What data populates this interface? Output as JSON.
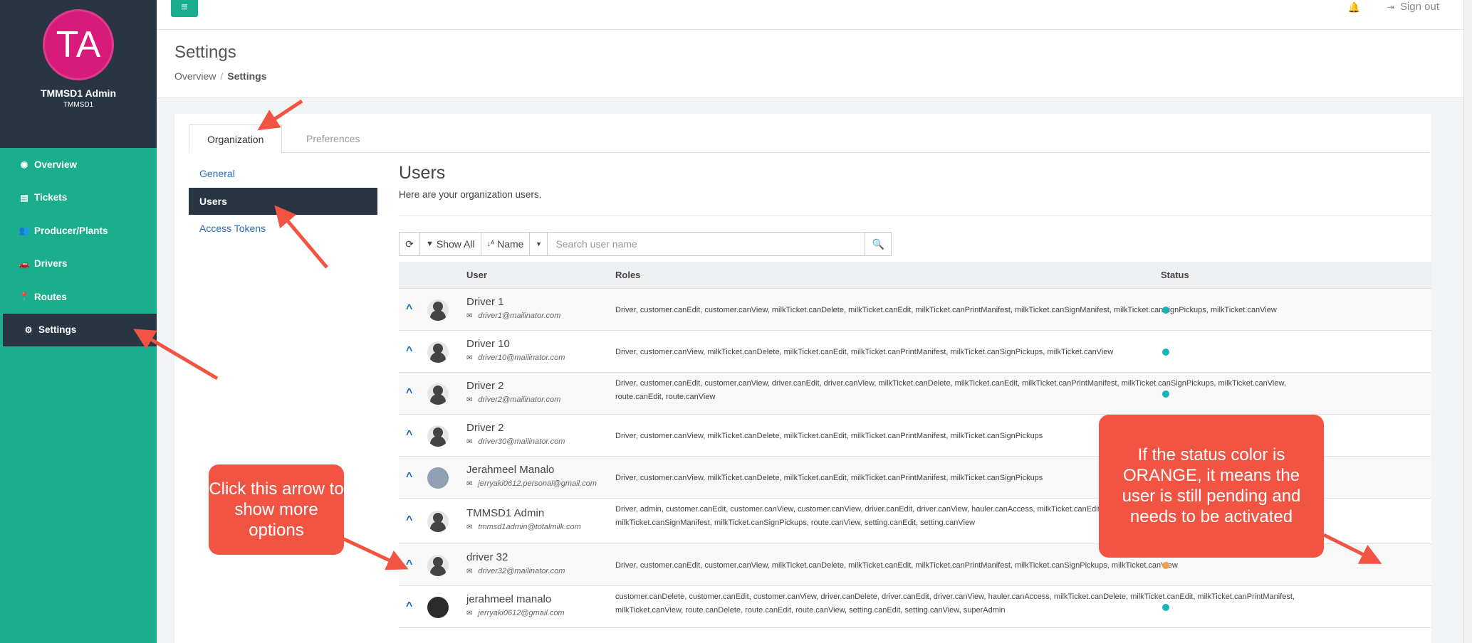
{
  "sidebar": {
    "avatar_initials": "TA",
    "admin_name": "TMMSD1 Admin",
    "admin_sub": "TMMSD1",
    "items": [
      {
        "label": "Overview",
        "icon": "dashboard-icon"
      },
      {
        "label": "Tickets",
        "icon": "file-icon"
      },
      {
        "label": "Producer/Plants",
        "icon": "users-icon"
      },
      {
        "label": "Drivers",
        "icon": "car-icon"
      },
      {
        "label": "Routes",
        "icon": "map-pin-icon"
      },
      {
        "label": "Settings",
        "icon": "gears-icon"
      }
    ]
  },
  "topbar": {
    "signout_label": "Sign out"
  },
  "header": {
    "title": "Settings",
    "breadcrumb": [
      "Overview",
      "Settings"
    ]
  },
  "tabs": [
    "Organization",
    "Preferences"
  ],
  "subnav": [
    "General",
    "Users",
    "Access Tokens"
  ],
  "users": {
    "title": "Users",
    "subtitle": "Here are your organization users.",
    "toolbar": {
      "show_all": "Show All",
      "sort_name": "Name",
      "search_placeholder": "Search user name"
    },
    "columns": {
      "user": "User",
      "roles": "Roles",
      "status": "Status"
    },
    "rows": [
      {
        "name": "Driver 1",
        "email": "driver1@mailinator.com",
        "roles": "Driver, customer.canEdit, customer.canView, milkTicket.canDelete, milkTicket.canEdit, milkTicket.canPrintManifest, milkTicket.canSignManifest, milkTicket.canSignPickups, milkTicket.canView",
        "status": "active"
      },
      {
        "name": "Driver 10",
        "email": "driver10@mailinator.com",
        "roles": "Driver, customer.canView, milkTicket.canDelete, milkTicket.canEdit, milkTicket.canPrintManifest, milkTicket.canSignPickups, milkTicket.canView",
        "status": "active"
      },
      {
        "name": "Driver 2",
        "email": "driver2@mailinator.com",
        "roles": "Driver, customer.canEdit, customer.canView, driver.canEdit, driver.canView, milkTicket.canDelete, milkTicket.canEdit, milkTicket.canPrintManifest, milkTicket.canSignPickups, milkTicket.canView, route.canEdit, route.canView",
        "status": "active"
      },
      {
        "name": "Driver 2",
        "email": "driver30@mailinator.com",
        "roles": "Driver, customer.canView, milkTicket.canDelete, milkTicket.canEdit, milkTicket.canPrintManifest, milkTicket.canSignPickups",
        "status": "active"
      },
      {
        "name": "Jerahmeel Manalo",
        "email": "jerryaki0612.personal@gmail.com",
        "roles": "Driver, customer.canView, milkTicket.canDelete, milkTicket.canEdit, milkTicket.canPrintManifest, milkTicket.canSignPickups",
        "status": "active"
      },
      {
        "name": "TMMSD1 Admin",
        "email": "tmmsd1admin@totalmilk.com",
        "roles": "Driver, admin, customer.canEdit, customer.canView, customer.canView, driver.canEdit, driver.canView, hauler.canAccess, milkTicket.canEdit, milkTicket.canPrintManifest, milkTicket.canPrintManifest, milkTicket.canSignManifest, milkTicket.canSignPickups, route.canView, setting.canEdit, setting.canView",
        "status": "active"
      },
      {
        "name": "driver 32",
        "email": "driver32@mailinator.com",
        "roles": "Driver, customer.canEdit, customer.canView, milkTicket.canDelete, milkTicket.canEdit, milkTicket.canPrintManifest, milkTicket.canSignPickups, milkTicket.canView",
        "status": "pending"
      },
      {
        "name": "jerahmeel manalo",
        "email": "jerryaki0612@gmail.com",
        "roles": "customer.canDelete, customer.canEdit, customer.canView, driver.canDelete, driver.canEdit, driver.canView, hauler.canAccess, milkTicket.canDelete, milkTicket.canEdit, milkTicket.canPrintManifest, milkTicket.canView, route.canDelete, route.canEdit, route.canView, setting.canEdit, setting.canView, superAdmin",
        "status": "active"
      }
    ]
  },
  "callouts": {
    "arrow_hint": "Click this arrow to show more options",
    "status_hint": "If the status color is ORANGE, it means the user is still pending and needs to be activated"
  },
  "colors": {
    "accent": "#1aae8c",
    "dark": "#2a3544",
    "status_active": "#17b3b8",
    "status_pending": "#f0a04a",
    "callout": "#f25443"
  }
}
